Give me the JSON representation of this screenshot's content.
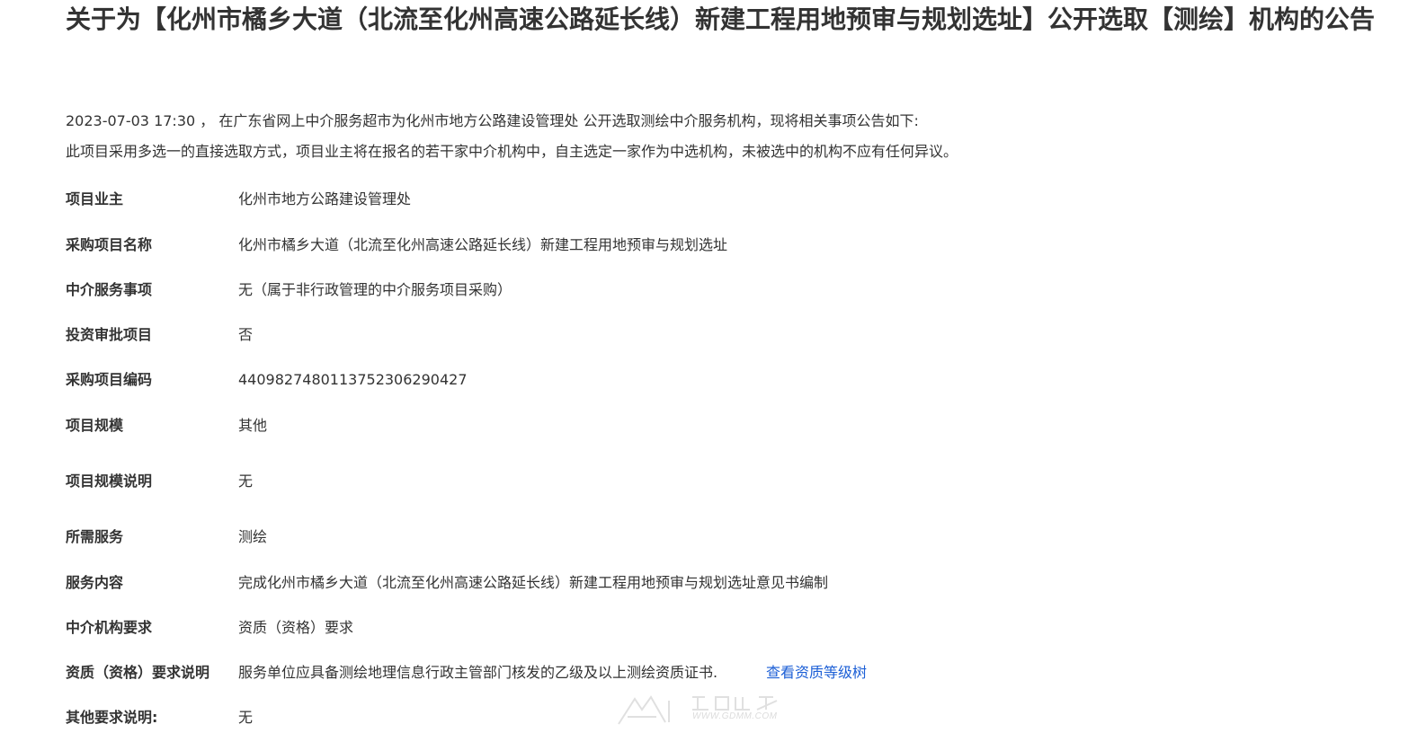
{
  "notice": {
    "title": "关于为【化州市橘乡大道（北流至化州高速公路延长线）新建工程用地预审与规划选址】公开选取【测绘】机构的公告",
    "intro_line1": "2023-07-03 17:30 ， 在广东省网上中介服务超市为化州市地方公路建设管理处 公开选取测绘中介服务机构，现将相关事项公告如下:",
    "intro_line2": "此项目采用多选一的直接选取方式，项目业主将在报名的若干家中介机构中，自主选定一家作为中选机构，未被选中的机构不应有任何异议。"
  },
  "details": [
    {
      "label": "项目业主",
      "value": "化州市地方公路建设管理处"
    },
    {
      "label": "采购项目名称",
      "value": "化州市橘乡大道（北流至化州高速公路延长线）新建工程用地预审与规划选址"
    },
    {
      "label": "中介服务事项",
      "value": "无（属于非行政管理的中介服务项目采购）"
    },
    {
      "label": "投资审批项目",
      "value": "否"
    },
    {
      "label": "采购项目编码",
      "value": "4409827480113752306290427"
    },
    {
      "label": "项目规模",
      "value": "其他"
    },
    {
      "label": "项目规模说明",
      "value": "无"
    },
    {
      "label": "所需服务",
      "value": "测绘"
    },
    {
      "label": "服务内容",
      "value": "完成化州市橘乡大道（北流至化州高速公路延长线）新建工程用地预审与规划选址意见书编制"
    },
    {
      "label": "中介机构要求",
      "value": "资质（资格）要求"
    },
    {
      "label": "资质（资格）要求说明",
      "value": "服务单位应具备测绘地理信息行政主管部门核发的乙级及以上测绘资质证书.",
      "link": "查看资质等级树"
    },
    {
      "label": "其他要求说明:",
      "value": "无"
    }
  ],
  "watermark": {
    "text": "WWW.GDMM.COM"
  }
}
